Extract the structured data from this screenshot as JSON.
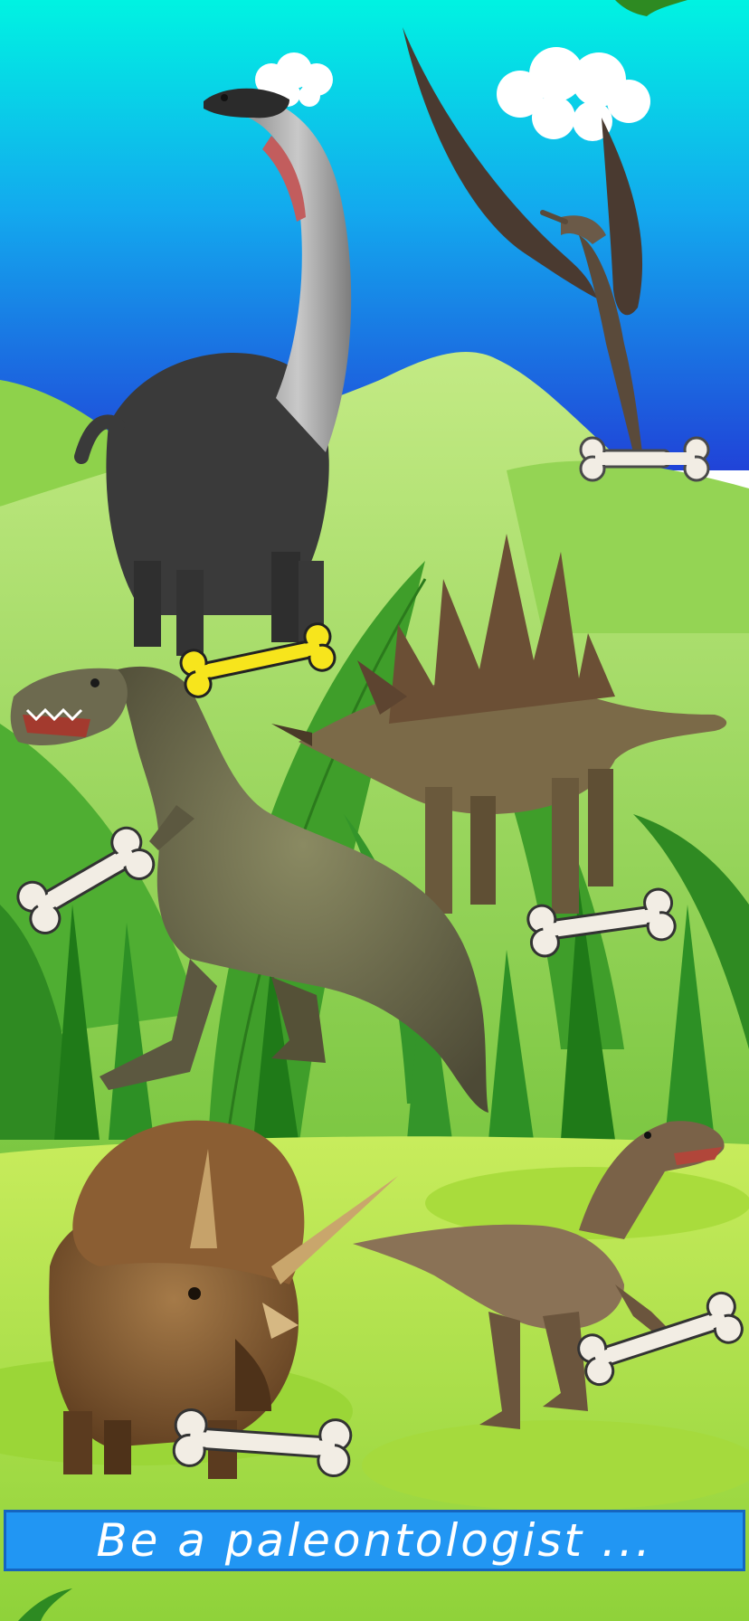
{
  "banner": {
    "text": "Be a paleontologist ..."
  },
  "colors": {
    "sky_top": "#00f0e0",
    "sky_bottom": "#1e5fe0",
    "hill": "#a8dd6a",
    "grass": "#7fcf3a",
    "meadow": "#b6e24a",
    "banner_bg": "#2196f3",
    "bone_default": "#f2ede4",
    "bone_highlight": "#f7e51c"
  },
  "scene": {
    "dinosaurs": [
      {
        "name": "brachiosaurus"
      },
      {
        "name": "pteranodon"
      },
      {
        "name": "tyrannosaurus"
      },
      {
        "name": "stegosaurus"
      },
      {
        "name": "triceratops"
      },
      {
        "name": "velociraptor"
      }
    ],
    "bones": [
      {
        "highlighted": false
      },
      {
        "highlighted": true
      },
      {
        "highlighted": false
      },
      {
        "highlighted": false
      },
      {
        "highlighted": false
      },
      {
        "highlighted": false
      }
    ]
  }
}
